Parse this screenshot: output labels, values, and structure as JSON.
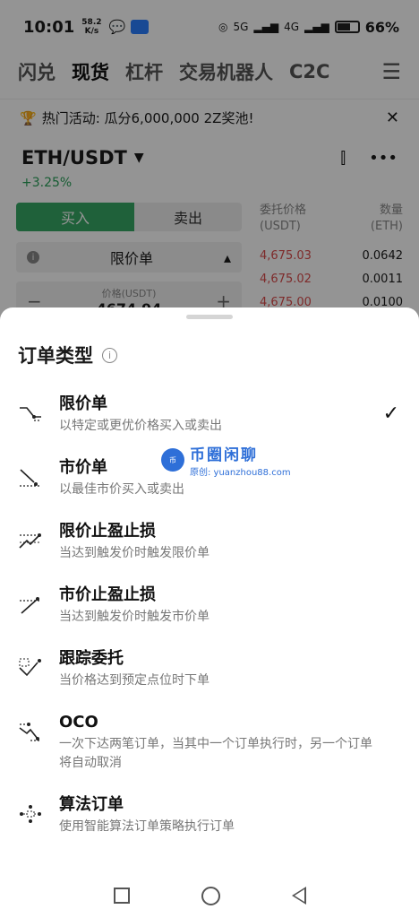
{
  "status_bar": {
    "time": "10:01",
    "net_speed_value": "58.2",
    "net_speed_unit": "K/s",
    "battery": "66%",
    "signal_1": "5G",
    "signal_2": "4G"
  },
  "nav_tabs": [
    "闪兑",
    "现货",
    "杠杆",
    "交易机器人",
    "C2C"
  ],
  "active_tab": "现货",
  "promo": {
    "text": "热门活动: 瓜分6,000,000 2Z奖池!"
  },
  "pair": {
    "name": "ETH/USDT",
    "change": "+3.25%"
  },
  "trade_form": {
    "buy": "买入",
    "sell": "卖出",
    "order_type": "限价单",
    "price_label": "价格(USDT)",
    "price_value": "4674.94"
  },
  "order_book": {
    "price_header": "委托价格",
    "price_unit": "(USDT)",
    "amount_header": "数量",
    "amount_unit": "(ETH)",
    "rows": [
      {
        "price": "4,675.03",
        "amount": "0.0642"
      },
      {
        "price": "4,675.02",
        "amount": "0.0011"
      },
      {
        "price": "4,675.00",
        "amount": "0.0100"
      }
    ]
  },
  "sheet": {
    "title": "订单类型",
    "options": [
      {
        "title": "限价单",
        "desc": "以特定或更优价格买入或卖出",
        "icon": "limit-order-icon",
        "selected": true
      },
      {
        "title": "市价单",
        "desc": "以最佳市价买入或卖出",
        "icon": "market-order-icon",
        "selected": false
      },
      {
        "title": "限价止盈止损",
        "desc": "当达到触发价时触发限价单",
        "icon": "limit-tpsl-icon",
        "selected": false
      },
      {
        "title": "市价止盈止损",
        "desc": "当达到触发价时触发市价单",
        "icon": "market-tpsl-icon",
        "selected": false
      },
      {
        "title": "跟踪委托",
        "desc": "当价格达到预定点位时下单",
        "icon": "trailing-order-icon",
        "selected": false
      },
      {
        "title": "OCO",
        "desc": "一次下达两笔订单，当其中一个订单执行时，另一个订单将自动取消",
        "icon": "oco-icon",
        "selected": false
      },
      {
        "title": "算法订单",
        "desc": "使用智能算法订单策略执行订单",
        "icon": "algo-order-icon",
        "selected": false
      }
    ]
  },
  "watermark": {
    "title": "币圈闲聊",
    "subtitle": "原创: yuanzhou88.com"
  },
  "colors": {
    "buy": "#36a865",
    "sell_price": "#d94a4a",
    "change": "#2aa05a"
  }
}
